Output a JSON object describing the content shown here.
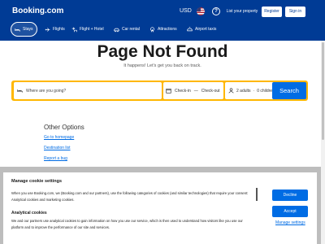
{
  "header": {
    "logo": "Booking.com",
    "currency": "USD",
    "help_glyph": "?",
    "list_property": "List your property",
    "register": "Register",
    "sign_in": "Sign in"
  },
  "nav": {
    "items": [
      {
        "label": "Stays",
        "icon": "bed-icon",
        "active": true
      },
      {
        "label": "Flights",
        "icon": "plane-icon",
        "active": false
      },
      {
        "label": "Flight + Hotel",
        "icon": "flight-hotel-icon",
        "active": false
      },
      {
        "label": "Car rental",
        "icon": "car-icon",
        "active": false
      },
      {
        "label": "Attractions",
        "icon": "attractions-icon",
        "active": false
      },
      {
        "label": "Airport taxis",
        "icon": "taxi-icon",
        "active": false
      }
    ]
  },
  "main": {
    "title": "Page Not Found",
    "subtitle": "It happens! Let's get you back on track."
  },
  "search": {
    "destination_placeholder": "Where are you going?",
    "check_in": "Check-in",
    "dash": "—",
    "check_out": "Check-out",
    "adults": "2 adults",
    "dot": "·",
    "children": "0 children",
    "button": "Search"
  },
  "other_options": {
    "title": "Other Options",
    "links": [
      "Go to homepage",
      "Destination list",
      "Report a bug"
    ]
  },
  "cookie": {
    "title": "Manage cookie settings",
    "text": "When you use Booking.com, we (Booking.com and our partners), use the following categories of cookies (and similar technologies) that require your consent: Analytical cookies and marketing cookies.",
    "analytics_title": "Analytical cookies",
    "analytics_text": "We and our partners use analytical cookies to gain information on how you use our service, which is then used to understand how visitors like you use our platform and to improve the performance of our site and services.",
    "decline": "Decline",
    "accept": "Accept",
    "manage": "Manage settings"
  },
  "colors": {
    "brand_blue": "#003b95",
    "action_blue": "#006ce4",
    "search_yellow": "#ffb700"
  }
}
